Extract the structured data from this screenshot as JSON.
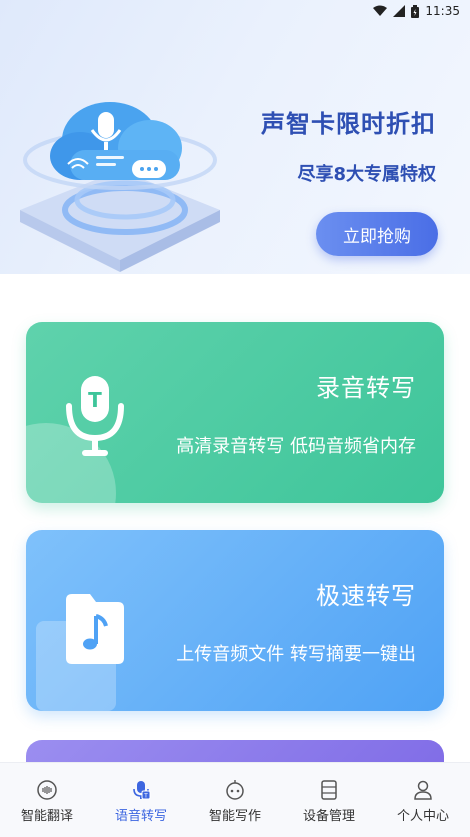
{
  "status_bar": {
    "time": "11:35",
    "icons": [
      "wifi-icon",
      "signal-icon",
      "battery-icon"
    ]
  },
  "banner": {
    "title": "声智卡限时折扣",
    "subtitle": "尽享8大专属特权",
    "button_label": "立即抢购"
  },
  "cards": [
    {
      "title": "录音转写",
      "desc": "高清录音转写 低码音频省内存",
      "icon": "microphone-t-icon",
      "color": "#46c99f"
    },
    {
      "title": "极速转写",
      "desc": "上传音频文件 转写摘要一键出",
      "icon": "music-file-icon",
      "color": "#5aa8f6"
    },
    {
      "title": "",
      "desc": "",
      "icon": "",
      "color": "#8b79ea"
    }
  ],
  "bottom_nav": {
    "items": [
      {
        "label": "智能翻译",
        "icon": "translate-icon",
        "active": false
      },
      {
        "label": "语音转写",
        "icon": "voice-transcribe-icon",
        "active": true
      },
      {
        "label": "智能写作",
        "icon": "writing-robot-icon",
        "active": false
      },
      {
        "label": "设备管理",
        "icon": "device-icon",
        "active": false
      },
      {
        "label": "个人中心",
        "icon": "person-icon",
        "active": false
      }
    ]
  },
  "colors": {
    "accent": "#3d66e0",
    "banner_text": "#2e4fb3",
    "green_card": "#46c99f",
    "blue_card": "#5aa8f6",
    "purple_card": "#8b79ea"
  }
}
